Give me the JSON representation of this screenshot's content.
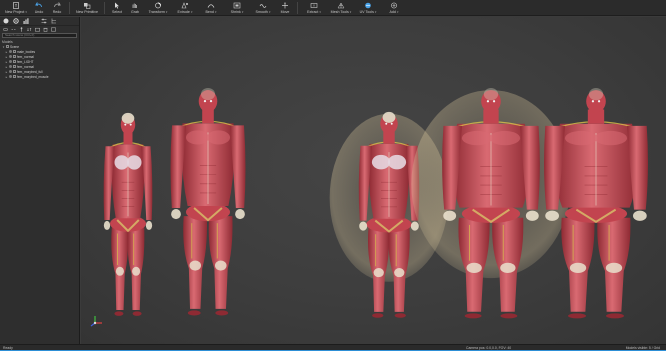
{
  "toolbar": [
    {
      "id": "new-project",
      "label": "New Project",
      "icon": "new-project-icon",
      "dropdown": true
    },
    {
      "id": "undo",
      "label": "Undo",
      "icon": "undo-icon",
      "dropdown": false
    },
    {
      "id": "redo",
      "label": "Redo",
      "icon": "redo-icon",
      "dropdown": false
    },
    {
      "id": "new-primitive",
      "label": "New Primitive",
      "icon": "primitive-icon",
      "dropdown": false
    },
    {
      "id": "select",
      "label": "Select",
      "icon": "select-arrow-icon",
      "dropdown": false
    },
    {
      "id": "grab",
      "label": "Grab",
      "icon": "grab-icon",
      "dropdown": false
    },
    {
      "id": "transform",
      "label": "Transform",
      "icon": "transform-icon",
      "dropdown": true
    },
    {
      "id": "extrude",
      "label": "Extrude",
      "icon": "extrude-icon",
      "dropdown": true
    },
    {
      "id": "bend",
      "label": "Bend",
      "icon": "bend-icon",
      "dropdown": true
    },
    {
      "id": "shrink",
      "label": "Shrink",
      "icon": "shrink-icon",
      "dropdown": true
    },
    {
      "id": "smooth",
      "label": "Smooth",
      "icon": "smooth-icon",
      "dropdown": true
    },
    {
      "id": "move",
      "label": "Move",
      "icon": "move-icon",
      "dropdown": false
    },
    {
      "id": "extract",
      "label": "Extract",
      "icon": "extract-icon",
      "dropdown": true
    },
    {
      "id": "mesh-tools",
      "label": "Mesh Tools",
      "icon": "mesh-tools-icon",
      "dropdown": true
    },
    {
      "id": "uv-tools",
      "label": "UV Tools",
      "icon": "uv-tools-icon",
      "dropdown": true
    },
    {
      "id": "add",
      "label": "Add",
      "icon": "add-icon",
      "dropdown": true
    }
  ],
  "panel": {
    "header": "Scene",
    "search_placeholder": "Search scene (Ctrl+F)",
    "group_label": "Models",
    "tree": [
      {
        "label": "Scene",
        "level": 0,
        "expanded": true
      },
      {
        "label": "male_bodies",
        "level": 1,
        "expanded": false
      },
      {
        "label": "fem_normal",
        "level": 1,
        "expanded": false
      },
      {
        "label": "fem_LIGHT",
        "level": 1,
        "expanded": false
      },
      {
        "label": "fem_normal",
        "level": 1,
        "expanded": false
      },
      {
        "label": "fem_morphed_full",
        "level": 1,
        "expanded": false
      },
      {
        "label": "fem_morphed_muscle",
        "level": 1,
        "expanded": false
      }
    ]
  },
  "status": {
    "left": "Ready",
    "middle": "Camera pos: 0.0,0.0, FOV: 40",
    "right": "Models visible: 5 / Grid"
  },
  "figures": [
    {
      "name": "figure-female-normal",
      "sex": "female",
      "build": 1.0,
      "shell": false
    },
    {
      "name": "figure-male-normal",
      "sex": "male",
      "build": 1.15,
      "shell": false
    },
    {
      "name": "figure-female-obese",
      "sex": "female",
      "build": 1.25,
      "shell": true
    },
    {
      "name": "figure-male-obese",
      "sex": "male",
      "build": 1.5,
      "shell": true
    },
    {
      "name": "figure-male-very-obese",
      "sex": "male",
      "build": 1.6,
      "shell": false
    }
  ],
  "colors": {
    "muscle": "#c2444f",
    "muscle_dark": "#8e2a33",
    "muscle_light": "#d96a72",
    "tendon": "#e9e0cc",
    "fat": "#d6c49a",
    "bone": "#ded7c4",
    "accent": "#2d8fd6"
  }
}
